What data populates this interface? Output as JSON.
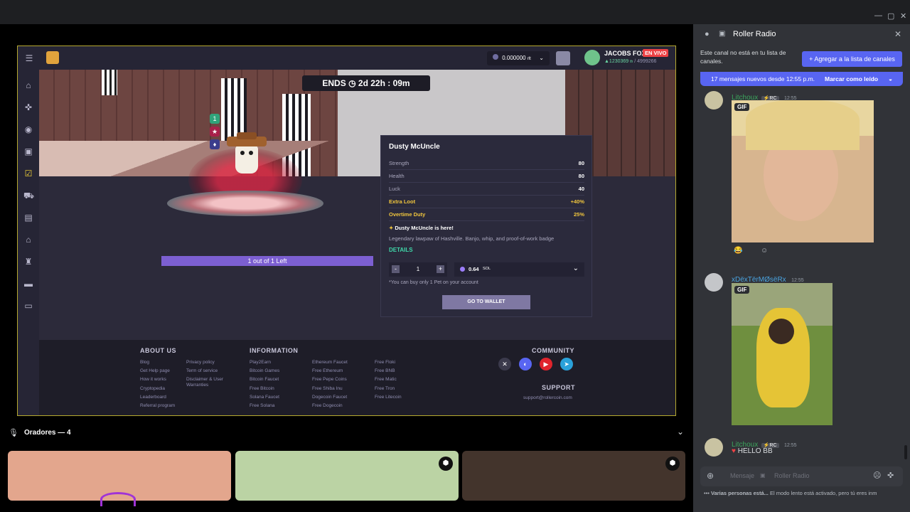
{
  "window": {
    "min_label": "—",
    "max_label": "▢",
    "close_label": "✕"
  },
  "game": {
    "topbar": {
      "balance": "0.000000",
      "balance_unit": "rlt",
      "username": "JACOBS FOX",
      "live_badge": "EN VIVO",
      "power": "▲1230369",
      "power_unit": "th",
      "rank": "/ 4999266"
    },
    "nav_icons": [
      "menu-icon",
      "home-icon",
      "gamepad-icon",
      "user-icon",
      "gift-icon",
      "tasks-icon",
      "cart-icon",
      "mining-icon",
      "house-icon",
      "trophy-icon",
      "stack-icon",
      "ticket-icon"
    ],
    "ends_label": "ENDS",
    "ends_value": "2d 22h : 09m",
    "badges": [
      "1",
      "★",
      "♦"
    ],
    "progress_text": "1 out of 1 Left",
    "progress_fraction": 1.0,
    "pet": {
      "name": "Dusty McUncle",
      "stats": [
        {
          "label": "Strength",
          "value": "80",
          "highlight": false
        },
        {
          "label": "Health",
          "value": "80",
          "highlight": false
        },
        {
          "label": "Luck",
          "value": "40",
          "highlight": false
        },
        {
          "label": "Extra Loot",
          "value": "+40%",
          "highlight": true
        },
        {
          "label": "Overtime Duty",
          "value": "25%",
          "highlight": true
        }
      ],
      "headline": "Dusty McUncle is here!",
      "description": "Legendary lawpaw of Hashville. Banjo, whip, and proof-of-work badge",
      "details_label": "DETAILS",
      "quantity": "1",
      "minus_label": "-",
      "plus_label": "+",
      "price": "0.64",
      "price_unit": "SOL",
      "note": "*You can buy only 1 Pet on your account",
      "wallet_button": "GO TO WALLET"
    },
    "footer": {
      "about_title": "ABOUT US",
      "about_col1": [
        "Blog",
        "Get Help page",
        "How it works",
        "Cryptopedia",
        "Leaderboard",
        "Referral program"
      ],
      "about_col2": [
        "Privacy policy",
        "Term of service",
        "Disclaimer & User",
        "Warranties"
      ],
      "info_title": "INFORMATION",
      "info_col1": [
        "Play2Earn",
        "Bitcoin Games",
        "Bitcoin Faucet",
        "Free Bitcoin",
        "Solana Faucet",
        "Free Solana"
      ],
      "info_col2": [
        "Ethereum Faucet",
        "Free Ethereum",
        "Free Pepe Coins",
        "Free Shiba Inu",
        "Dogecoin Faucet",
        "Free Dogecoin"
      ],
      "info_col3": [
        "Free Floki",
        "Free BNB",
        "Free Matic",
        "Free Tron",
        "Free Litecoin"
      ],
      "community_title": "COMMUNITY",
      "support_title": "SUPPORT",
      "support_email": "support@rollercoin.com"
    }
  },
  "speakers": {
    "label": "Oradores — 4"
  },
  "chat": {
    "channel": "Roller Radio",
    "notice": "Este canal no está en tu lista de canales.",
    "add_button": "Agregar a la lista de canales",
    "new_messages": "17 mensajes nuevos desde 12:55 p.m.",
    "mark_read": "Marcar como leído",
    "messages": [
      {
        "author": "Litchoux",
        "tag": "RC",
        "time": "12:55",
        "gif": "GIF"
      },
      {
        "author": "xDëxTërMØsëRx",
        "time": "12:55",
        "gif": "GIF"
      },
      {
        "author": "Litchoux",
        "tag": "RC",
        "time": "12:55",
        "text": "HELLO BB"
      }
    ],
    "composer_placeholder": "Mensaje",
    "composer_channel": "Roller Radio",
    "typing": "Varias personas está...",
    "slow_mode": "El modo lento está activado, pero tú eres inm"
  },
  "colors": {
    "accent": "#5865f2",
    "live": "#ed4245",
    "pet_highlight": "#f1c63d",
    "details": "#3fd6a8"
  }
}
